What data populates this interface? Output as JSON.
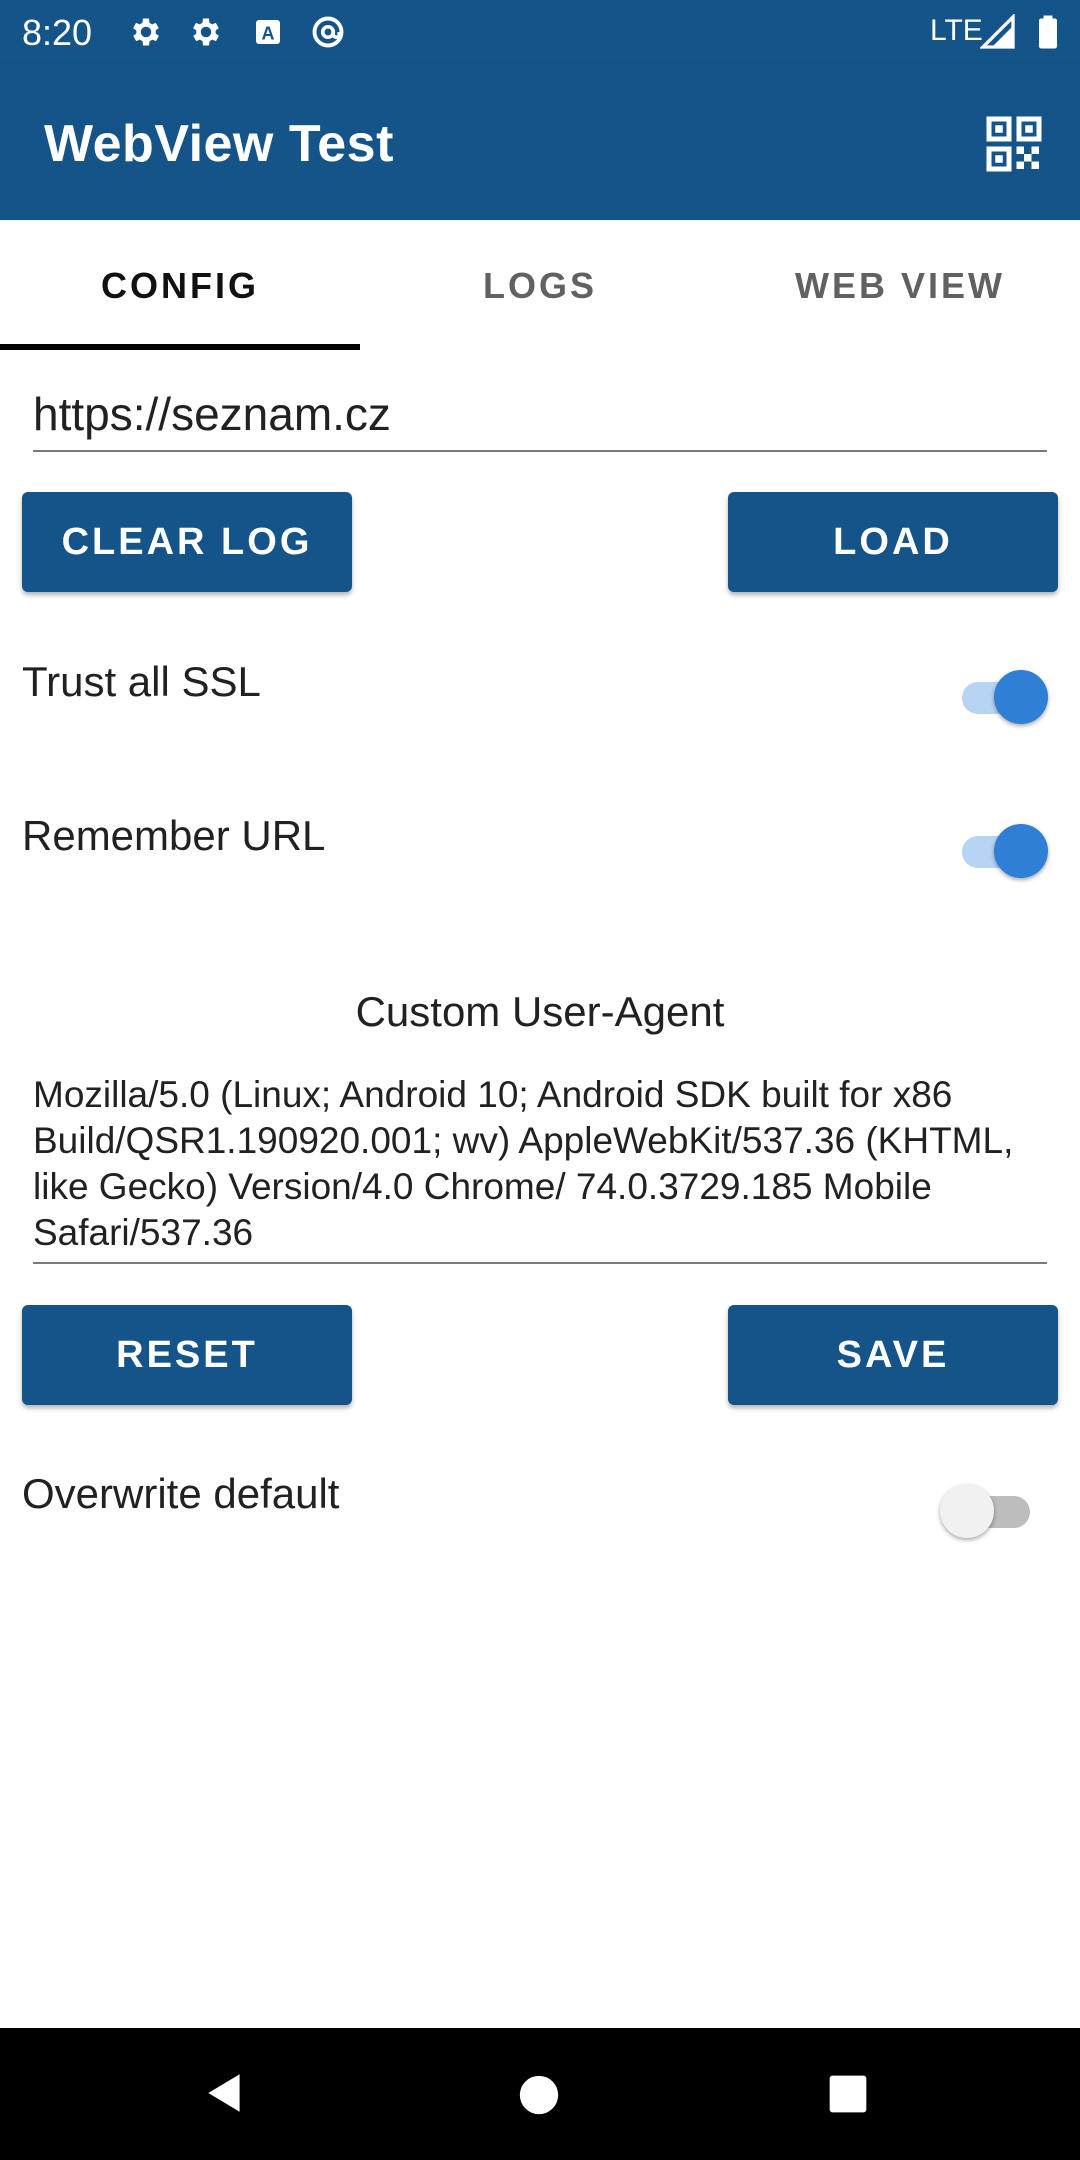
{
  "status_bar": {
    "time": "8:20",
    "network": "LTE",
    "icons": [
      "settings-icon",
      "settings-icon",
      "a-badge-icon",
      "at-sign-icon",
      "signal-icon",
      "battery-icon"
    ]
  },
  "app_bar": {
    "title": "WebView Test",
    "action_icon": "qr-code-icon",
    "color": "#155488"
  },
  "tabs": [
    {
      "label": "CONFIG",
      "active": true
    },
    {
      "label": "LOGS",
      "active": false
    },
    {
      "label": "WEB VIEW",
      "active": false
    }
  ],
  "url_field": {
    "value": "https://seznam.cz"
  },
  "buttons": {
    "clear_log": "CLEAR LOG",
    "load": "LOAD",
    "reset": "RESET",
    "save": "SAVE"
  },
  "settings": {
    "trust_ssl": {
      "label": "Trust all SSL",
      "on": true
    },
    "remember_url": {
      "label": "Remember URL",
      "on": true
    },
    "overwrite_default": {
      "label": "Overwrite default",
      "on": false
    }
  },
  "user_agent": {
    "title": "Custom User-Agent",
    "value": "Mozilla/5.0 (Linux; Android 10; Android SDK built for x86 Build/QSR1.190920.001; wv) AppleWebKit/537.36 (KHTML, like Gecko) Version/4.0 Chrome/ 74.0.3729.185 Mobile Safari/537.36"
  },
  "nav_bar": {
    "icons": [
      "back-icon",
      "home-icon",
      "recents-icon"
    ]
  }
}
